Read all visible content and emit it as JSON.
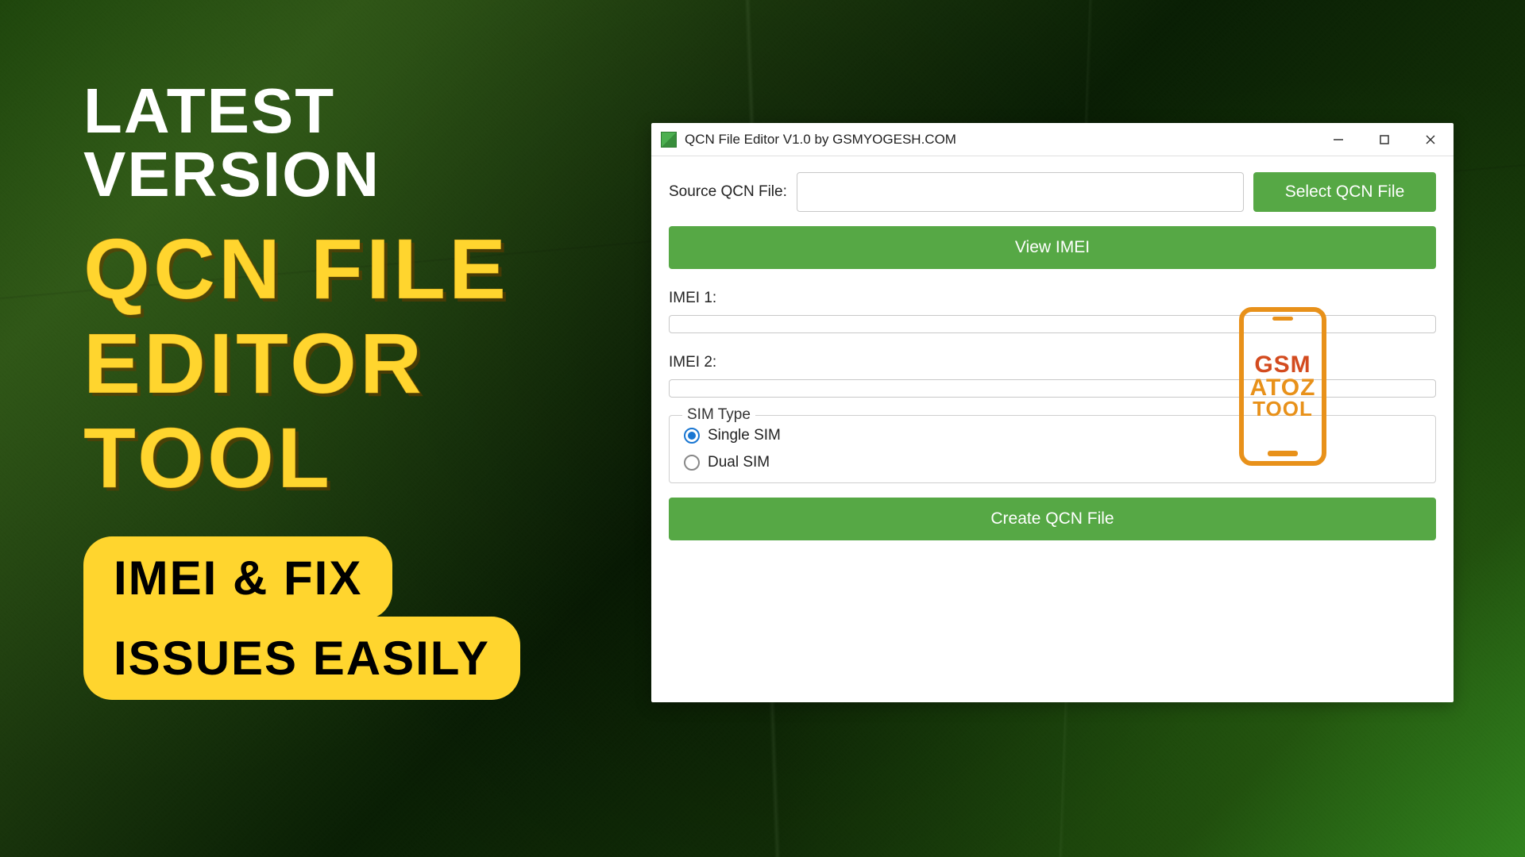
{
  "promo": {
    "line1": "LATEST VERSION",
    "line2a": "QCN FILE",
    "line2b": "EDITOR",
    "line2c": "TOOL",
    "badge1": "IMEI & FIX",
    "badge2": "ISSUES EASILY"
  },
  "window": {
    "title": "QCN File Editor V1.0 by GSMYOGESH.COM",
    "source_label": "Source QCN File:",
    "source_value": "",
    "select_btn": "Select QCN File",
    "view_btn": "View IMEI",
    "imei1_label": "IMEI 1:",
    "imei1_value": "",
    "imei2_label": "IMEI 2:",
    "imei2_value": "",
    "sim_legend": "SIM Type",
    "sim_single": "Single SIM",
    "sim_dual": "Dual SIM",
    "sim_selected": "single",
    "create_btn": "Create QCN File"
  },
  "watermark": {
    "l1": "GSM",
    "l2": "ATOZ",
    "l3": "TOOL"
  },
  "colors": {
    "accent_green": "#56a845",
    "accent_yellow": "#ffd52e",
    "accent_blue": "#1976d2",
    "watermark_orange": "#e8911a"
  }
}
